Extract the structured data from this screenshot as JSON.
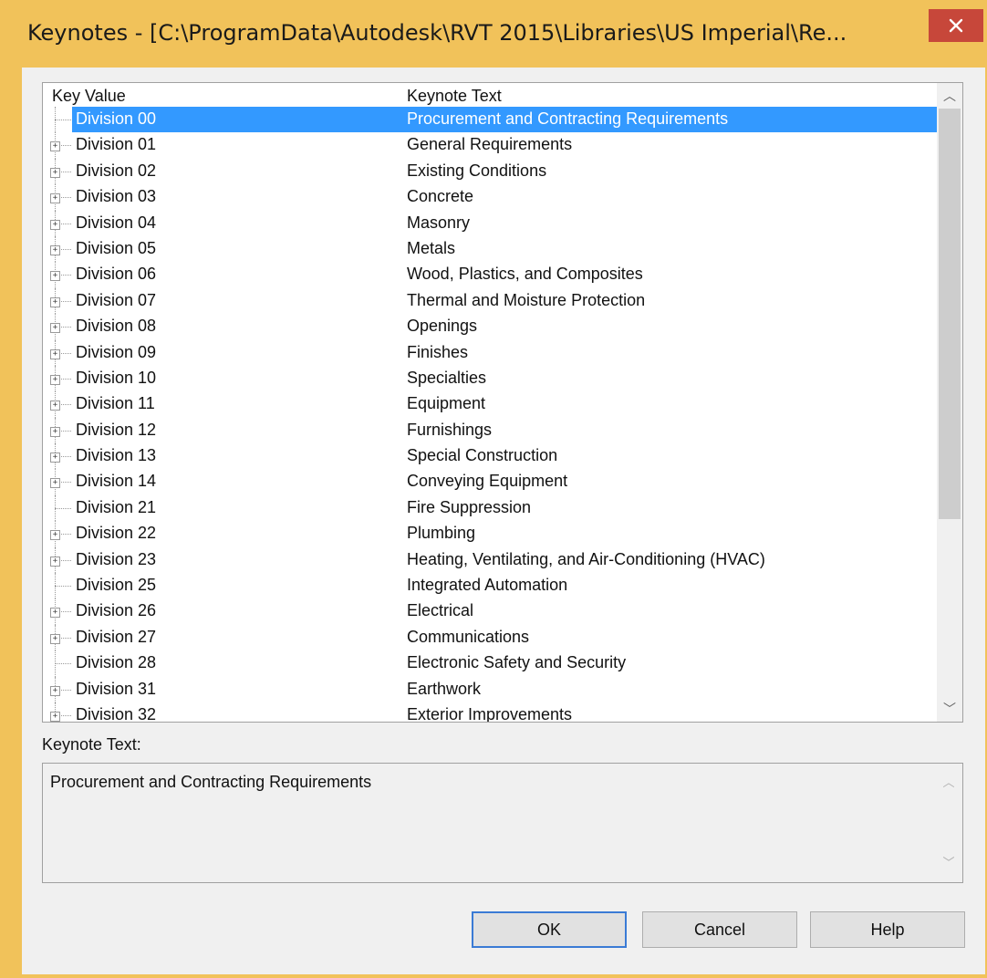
{
  "window": {
    "title": "Keynotes - [C:\\ProgramData\\Autodesk\\RVT 2015\\Libraries\\US Imperial\\Re...",
    "close_glyph": "✕",
    "frame_color": "#f1c25a",
    "close_color": "#c7473a"
  },
  "tree": {
    "headers": {
      "key": "Key Value",
      "text": "Keynote Text"
    },
    "selection_color": "#3399ff",
    "rows": [
      {
        "key": "Division 00",
        "text": "Procurement and Contracting Requirements",
        "expandable": false,
        "selected": true
      },
      {
        "key": "Division 01",
        "text": "General Requirements",
        "expandable": true
      },
      {
        "key": "Division 02",
        "text": "Existing Conditions",
        "expandable": true
      },
      {
        "key": "Division 03",
        "text": "Concrete",
        "expandable": true
      },
      {
        "key": "Division 04",
        "text": "Masonry",
        "expandable": true
      },
      {
        "key": "Division 05",
        "text": "Metals",
        "expandable": true
      },
      {
        "key": "Division 06",
        "text": "Wood, Plastics, and Composites",
        "expandable": true
      },
      {
        "key": "Division 07",
        "text": "Thermal and Moisture Protection",
        "expandable": true
      },
      {
        "key": "Division 08",
        "text": "Openings",
        "expandable": true
      },
      {
        "key": "Division 09",
        "text": "Finishes",
        "expandable": true
      },
      {
        "key": "Division 10",
        "text": "Specialties",
        "expandable": true
      },
      {
        "key": "Division 11",
        "text": "Equipment",
        "expandable": true
      },
      {
        "key": "Division 12",
        "text": "Furnishings",
        "expandable": true
      },
      {
        "key": "Division 13",
        "text": "Special Construction",
        "expandable": true
      },
      {
        "key": "Division 14",
        "text": "Conveying Equipment",
        "expandable": true
      },
      {
        "key": "Division 21",
        "text": "Fire Suppression",
        "expandable": false
      },
      {
        "key": "Division 22",
        "text": "Plumbing",
        "expandable": true
      },
      {
        "key": "Division 23",
        "text": "Heating, Ventilating, and Air-Conditioning (HVAC)",
        "expandable": true
      },
      {
        "key": "Division 25",
        "text": "Integrated Automation",
        "expandable": false
      },
      {
        "key": "Division 26",
        "text": "Electrical",
        "expandable": true
      },
      {
        "key": "Division 27",
        "text": "Communications",
        "expandable": true
      },
      {
        "key": "Division 28",
        "text": "Electronic Safety and Security",
        "expandable": false
      },
      {
        "key": "Division 31",
        "text": "Earthwork",
        "expandable": true
      },
      {
        "key": "Division 32",
        "text": "Exterior Improvements",
        "expandable": true
      }
    ],
    "scroll_up_glyph": "︿",
    "scroll_down_glyph": "﹀"
  },
  "detail": {
    "label": "Keynote Text:",
    "value": "Procurement and Contracting Requirements"
  },
  "buttons": {
    "ok": "OK",
    "cancel": "Cancel",
    "help": "Help"
  }
}
